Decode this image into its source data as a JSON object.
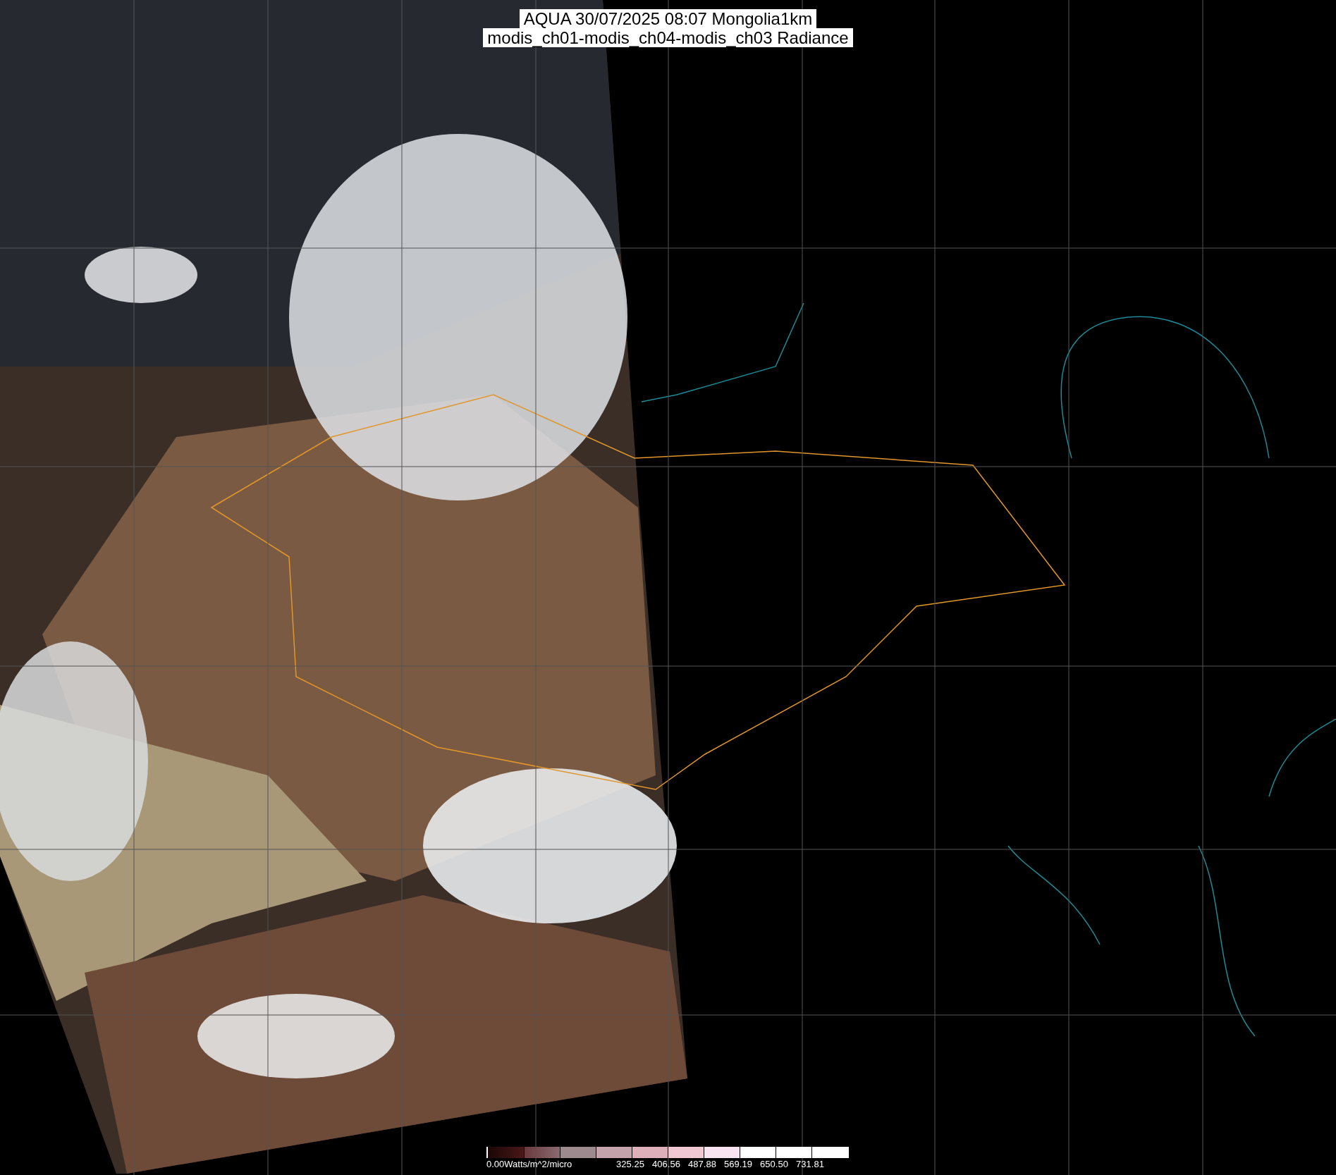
{
  "title": {
    "line_1": "AQUA 30/07/2025 08:07 Mongolia1km",
    "line_2": "modis_ch01-modis_ch04-modis_ch03 Radiance"
  },
  "colorbar": {
    "unit_label": "0.00Watts/m^2/micro",
    "ticks": [
      "325.25",
      "406.56",
      "487.88",
      "569.19",
      "650.50",
      "731.81"
    ]
  }
}
